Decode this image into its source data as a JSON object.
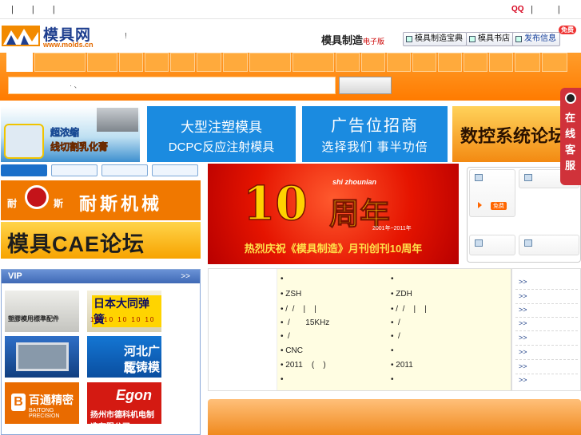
{
  "topbar": {
    "left_separators": "| | |",
    "qq_label": "QQ",
    "right_separators": "| |"
  },
  "header": {
    "logo_text": "模具网",
    "logo_url": "www.molds.cn",
    "sep": "!",
    "magazine_title": "模具制造",
    "magazine_sub": "电子版",
    "btn_dictionary": "模具制造宝典",
    "btn_bookstore": "模具书店",
    "btn_publish": "发布信息",
    "publish_badge": "免费"
  },
  "nav": {
    "search_hint": "· 、"
  },
  "banners": {
    "b1_line1": "超浓缩",
    "b1_line2": "线切割乳化膏",
    "b2_line1": "大型注塑模具",
    "b2_line2": "DCPC反应注射模具",
    "b3_line1": "广告位招商",
    "b3_line2": "选择我们 事半功倍",
    "b4_line1": "数控系统论坛"
  },
  "left_ads": {
    "nais_nai": "耐",
    "nais_si": "斯",
    "nais_text": "耐斯机械",
    "cae_text": "模具CAE论坛"
  },
  "anniversary": {
    "number": "10",
    "word": "周年",
    "english": "shi zhounian",
    "years": "2001年~2011年",
    "footer": "热烈庆祝《模具制造》月刊创刊10周年"
  },
  "right_panel": {
    "badge": "免费"
  },
  "vip": {
    "title": "VIP",
    "more": ">>",
    "v1_text": "塑膠模用標準配件",
    "v2_text": "日本大同弹簧",
    "v2_nums": "10 10 10 10 10",
    "v4_line1": "河北广乾",
    "v4_line2": "压铸模具",
    "v5_logo": "B",
    "v5_text": "百通精密",
    "v5_sub": "BAITONG PRECISION",
    "v6_brand": "Egon",
    "v6_text": "扬州市德科机电制造有限公司"
  },
  "list": {
    "left_rows": [
      "•",
      "• ZSH",
      "• /  /    |    |",
      "•  /       15KHz",
      "•  /",
      "• CNC",
      "• 2011    (    )",
      "•"
    ],
    "right_rows": [
      "•",
      "• ZDH",
      "• /  /    |    |",
      "•  /",
      "•  /",
      "•",
      "• 2011",
      "•"
    ],
    "more_links": [
      ">>",
      ">>",
      ">>",
      ">>",
      ">>",
      ">>",
      ">>",
      ">>"
    ]
  },
  "kefu": {
    "text": "在线客服"
  }
}
